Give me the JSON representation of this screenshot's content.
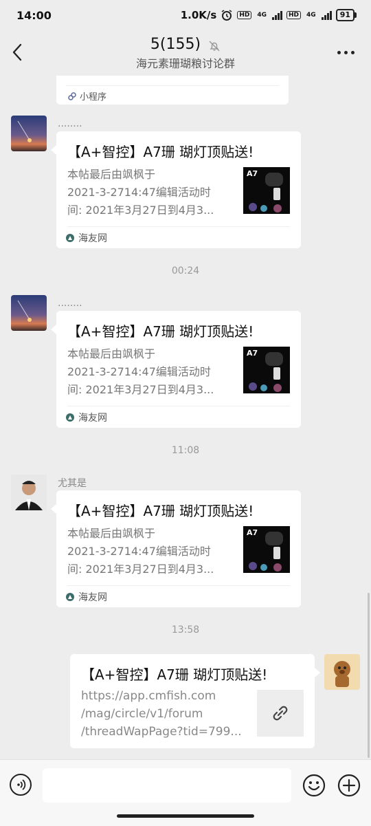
{
  "status_bar": {
    "time": "14:00",
    "net_speed": "1.0K/s",
    "hd1": "HD",
    "net1": "4G",
    "hd2": "HD",
    "net2": "4G",
    "battery": "91"
  },
  "header": {
    "title": "5(155)",
    "subtitle": "海元素珊瑚粮讨论群"
  },
  "partial_card": {
    "source": "小程序"
  },
  "messages": [
    {
      "sender": "........",
      "title": "【A+智控】A7珊 瑚灯顶贴送!",
      "desc_lines": [
        "本帖最后由飒枫于",
        "2021-3-2714:47编辑活动时",
        "间: 2021年3月27日到4月3..."
      ],
      "thumb_label": "A7",
      "source": "海友网"
    },
    {
      "sender": "........",
      "title": "【A+智控】A7珊 瑚灯顶贴送!",
      "desc_lines": [
        "本帖最后由飒枫于",
        "2021-3-2714:47编辑活动时",
        "间: 2021年3月27日到4月3..."
      ],
      "thumb_label": "A7",
      "source": "海友网"
    },
    {
      "sender": "尤其是",
      "title": "【A+智控】A7珊 瑚灯顶贴送!",
      "desc_lines": [
        "本帖最后由飒枫于",
        "2021-3-2714:47编辑活动时",
        "间: 2021年3月27日到4月3..."
      ],
      "thumb_label": "A7",
      "source": "海友网"
    }
  ],
  "timestamps": [
    "00:24",
    "11:08",
    "13:58"
  ],
  "my_message": {
    "title": "【A+智控】A7珊 瑚灯顶贴送!",
    "url_lines": [
      "https://app.cmfish.com",
      "/mag/circle/v1/forum",
      "/threadWapPage?tid=799..."
    ]
  },
  "colors": {
    "background": "#ededed",
    "bubble": "#ffffff",
    "muted_text": "#777777"
  }
}
